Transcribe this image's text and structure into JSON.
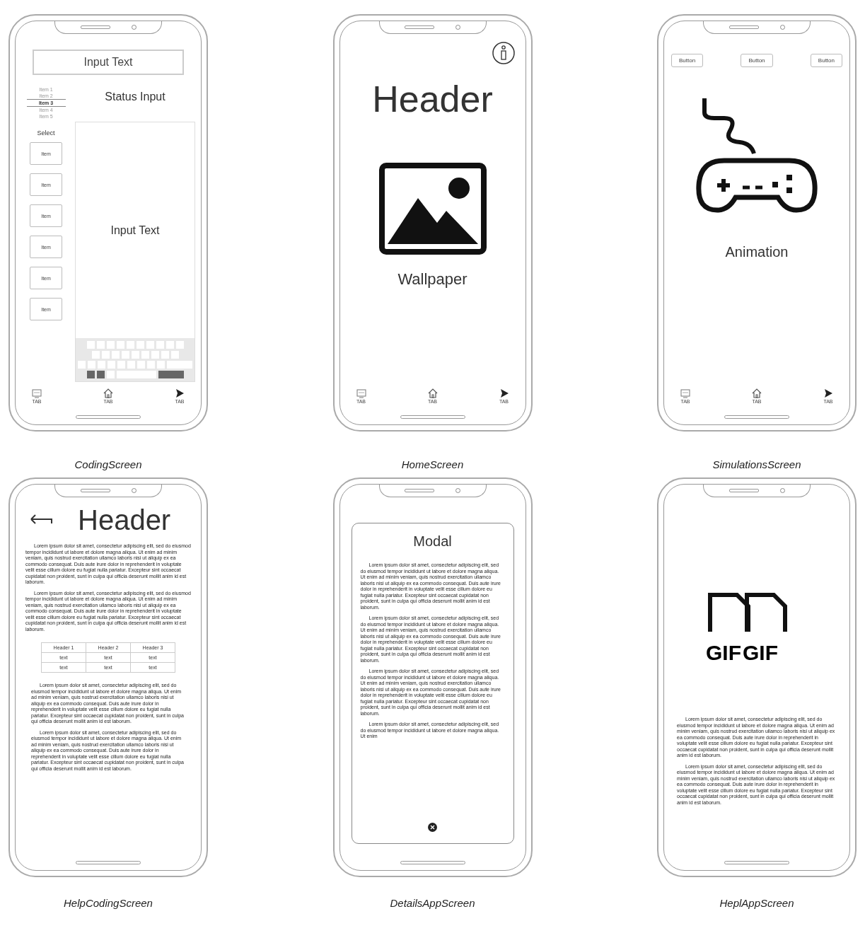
{
  "screens": [
    {
      "kind": "coding",
      "caption": "CodingScreen",
      "input_text": "Input Text",
      "picker": [
        {
          "label": "Item 1",
          "selected": false
        },
        {
          "label": "Item 2",
          "selected": false
        },
        {
          "label": "Item 3",
          "selected": true
        },
        {
          "label": "Item 4",
          "selected": false
        },
        {
          "label": "Item 5",
          "selected": false
        }
      ],
      "status": "Status Input",
      "select_label": "Select",
      "select_items": [
        "Item",
        "Item",
        "Item",
        "Item",
        "Item",
        "Item"
      ],
      "editor_text": "Input Text",
      "tabs": [
        "TAB",
        "TAB",
        "TAB"
      ]
    },
    {
      "kind": "home",
      "caption": "HomeScreen",
      "header": "Header",
      "image_caption": "Wallpaper",
      "tabs": [
        "TAB",
        "TAB",
        "TAB"
      ]
    },
    {
      "kind": "simulations",
      "caption": "SimulationsScreen",
      "buttons": [
        "Button",
        "Button",
        "Button"
      ],
      "image_caption": "Animation",
      "tabs": [
        "TAB",
        "TAB",
        "TAB"
      ]
    },
    {
      "kind": "help_coding",
      "caption": "HelpCodingScreen",
      "header": "Header",
      "paragraphs_before": [
        "Lorem ipsum dolor sit amet, consectetur adipiscing elit, sed do eiusmod tempor incididunt ut labore et dolore magna aliqua. Ut enim ad minim veniam, quis nostrud exercitation ullamco laboris nisi ut aliquip ex ea commodo consequat. Duis aute irure dolor in reprehenderit in voluptate velit esse cillum dolore eu fugiat nulla pariatur. Excepteur sint occaecat cupidatat non proident, sunt in culpa qui officia deserunt mollit anim id est laborum.",
        "Lorem ipsum dolor sit amet, consectetur adipiscing elit, sed do eiusmod tempor incididunt ut labore et dolore magna aliqua. Ut enim ad minim veniam, quis nostrud exercitation ullamco laboris nisi ut aliquip ex ea commodo consequat. Duis aute irure dolor in reprehenderit in voluptate velit esse cillum dolore eu fugiat nulla pariatur. Excepteur sint occaecat cupidatat non proident, sunt in culpa qui officia deserunt mollit anim id est laborum."
      ],
      "table": {
        "columns": [
          "Header 1",
          "Header 2",
          "Header 3"
        ],
        "rows": [
          [
            "text",
            "text",
            "text"
          ],
          [
            "text",
            "text",
            "text"
          ]
        ]
      },
      "paragraphs_after": [
        "Lorem ipsum dolor sit amet, consectetur adipiscing elit, sed do eiusmod tempor incididunt ut labore et dolore magna aliqua. Ut enim ad minim veniam, quis nostrud exercitation ullamco laboris nisi ut aliquip ex ea commodo consequat. Duis aute irure dolor in reprehenderit in voluptate velit esse cillum dolore eu fugiat nulla pariatur. Excepteur sint occaecat cupidatat non proident, sunt in culpa qui officia deserunt mollit anim id est laborum.",
        "Lorem ipsum dolor sit amet, consectetur adipiscing elit, sed do eiusmod tempor incididunt ut labore et dolore magna aliqua. Ut enim ad minim veniam, quis nostrud exercitation ullamco laboris nisi ut aliquip ex ea commodo consequat. Duis aute irure dolor in reprehenderit in voluptate velit esse cillum dolore eu fugiat nulla pariatur. Excepteur sint occaecat cupidatat non proident, sunt in culpa qui officia deserunt mollit anim id est laborum."
      ]
    },
    {
      "kind": "details",
      "caption": "DetailsAppScreen",
      "modal_title": "Modal",
      "paragraphs": [
        "Lorem ipsum dolor sit amet, consectetur adipiscing elit, sed do eiusmod tempor incididunt ut labore et dolore magna aliqua. Ut enim ad minim veniam, quis nostrud exercitation ullamco laboris nisi ut aliquip ex ea commodo consequat. Duis aute irure dolor in reprehenderit in voluptate velit esse cillum dolore eu fugiat nulla pariatur. Excepteur sint occaecat cupidatat non proident, sunt in culpa qui officia deserunt mollit anim id est laborum.",
        "Lorem ipsum dolor sit amet, consectetur adipiscing elit, sed do eiusmod tempor incididunt ut labore et dolore magna aliqua. Ut enim ad minim veniam, quis nostrud exercitation ullamco laboris nisi ut aliquip ex ea commodo consequat. Duis aute irure dolor in reprehenderit in voluptate velit esse cillum dolore eu fugiat nulla pariatur. Excepteur sint occaecat cupidatat non proident, sunt in culpa qui officia deserunt mollit anim id est laborum.",
        "Lorem ipsum dolor sit amet, consectetur adipiscing elit, sed do eiusmod tempor incididunt ut labore et dolore magna aliqua. Ut enim ad minim veniam, quis nostrud exercitation ullamco laboris nisi ut aliquip ex ea commodo consequat. Duis aute irure dolor in reprehenderit in voluptate velit esse cillum dolore eu fugiat nulla pariatur. Excepteur sint occaecat cupidatat non proident, sunt in culpa qui officia deserunt mollit anim id est laborum.",
        "Lorem ipsum dolor sit amet, consectetur adipiscing elit, sed do eiusmod tempor incididunt ut labore et dolore magna aliqua. Ut enim"
      ]
    },
    {
      "kind": "help_app",
      "caption": "HeplAppScreen",
      "gif_labels": [
        "GIF",
        "GIF"
      ],
      "paragraphs": [
        "Lorem ipsum dolor sit amet, consectetur adipiscing elit, sed do eiusmod tempor incididunt ut labore et dolore magna aliqua. Ut enim ad minim veniam, quis nostrud exercitation ullamco laboris nisi ut aliquip ex ea commodo consequat. Duis aute irure dolor in reprehenderit in voluptate velit esse cillum dolore eu fugiat nulla pariatur. Excepteur sint occaecat cupidatat non proident, sunt in culpa qui officia deserunt mollit anim id est laborum.",
        "Lorem ipsum dolor sit amet, consectetur adipiscing elit, sed do eiusmod tempor incididunt ut labore et dolore magna aliqua. Ut enim ad minim veniam, quis nostrud exercitation ullamco laboris nisi ut aliquip ex ea commodo consequat. Duis aute irure dolor in reprehenderit in voluptate velit esse cillum dolore eu fugiat nulla pariatur. Excepteur sint occaecat cupidatat non proident, sunt in culpa qui officia deserunt mollit anim id est laborum."
      ]
    }
  ]
}
